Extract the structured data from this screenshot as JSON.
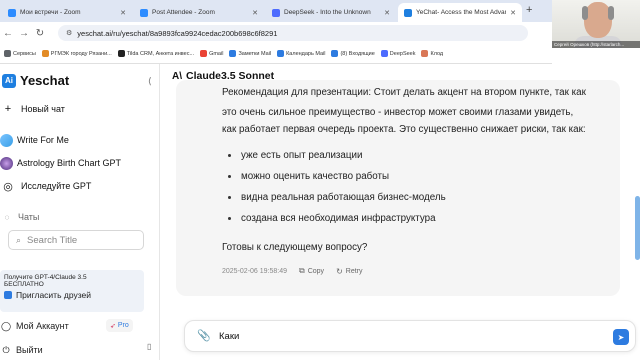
{
  "browser": {
    "tabs": [
      {
        "title": "Мои встречи - Zoom",
        "color": "#2d8cff"
      },
      {
        "title": "Post Attendee - Zoom",
        "color": "#2d8cff"
      },
      {
        "title": "DeepSeek - Into the Unknown",
        "color": "#4d6bfe"
      },
      {
        "title": "YeChat- Access the Most Advanced G",
        "color": "#1e7fe0"
      }
    ],
    "new_tab": "+",
    "url": "yeschat.ai/ru/yeschat/8a9893fca9924cedac200b698c6f8291",
    "bookmarks": [
      {
        "label": "Сервисы",
        "color": "#5f6368"
      },
      {
        "label": "РГМЭК городу Рязани...",
        "color": "#e28b26"
      },
      {
        "label": "Tilda CRM, Анкета инвес...",
        "color": "#222222"
      },
      {
        "label": "Gmail",
        "color": "#ea4335"
      },
      {
        "label": "Заметки Mail",
        "color": "#2d7be0"
      },
      {
        "label": "Календарь Mail",
        "color": "#2d7be0"
      },
      {
        "label": "(8) Входящие",
        "color": "#2d7be0"
      },
      {
        "label": "DeepSeek",
        "color": "#4d6bfe"
      },
      {
        "label": "Клод",
        "color": "#d97757"
      }
    ]
  },
  "webcam": {
    "caption": "Сергей Орешков (http://starlarch..."
  },
  "sidebar": {
    "logo_letter": "Ai",
    "brand": "Yeschat",
    "new_chat": "Новый чат",
    "items": [
      {
        "label": "Write For Me"
      },
      {
        "label": "Astrology Birth Chart GPT"
      },
      {
        "label": "Исследуйте GPT"
      }
    ],
    "chats_label": "Чаты",
    "search_placeholder": "Search Title",
    "promo": {
      "line1": "Получите GPT-4/Claude 3.5",
      "line2": "БЕСПЛАТНО",
      "invite": "Пригласить друзей"
    },
    "account_label": "Мой Аккаунт",
    "pro_badge": "Pro",
    "logout_label": "Выйти"
  },
  "chat": {
    "model_name": "Claude3.5 Sonnet",
    "paragraph_lines": [
      "Рекомендация для презентации: Стоит делать акцент на втором пункте, так как",
      "это очень сильное преимущество - инвестор может своими глазами увидеть,",
      "как работает первая очередь проекта. Это существенно снижает риски, так как:"
    ],
    "bullets": [
      "уже есть опыт реализации",
      "можно оценить качество работы",
      "видна реальная работающая бизнес-модель",
      "создана вся необходимая инфраструктура"
    ],
    "closing": "Готовы к следующему вопросу?",
    "timestamp": "2025-02-06 19:58:49",
    "copy_label": "Copy",
    "retry_label": "Retry"
  },
  "composer": {
    "value": "Каки"
  }
}
